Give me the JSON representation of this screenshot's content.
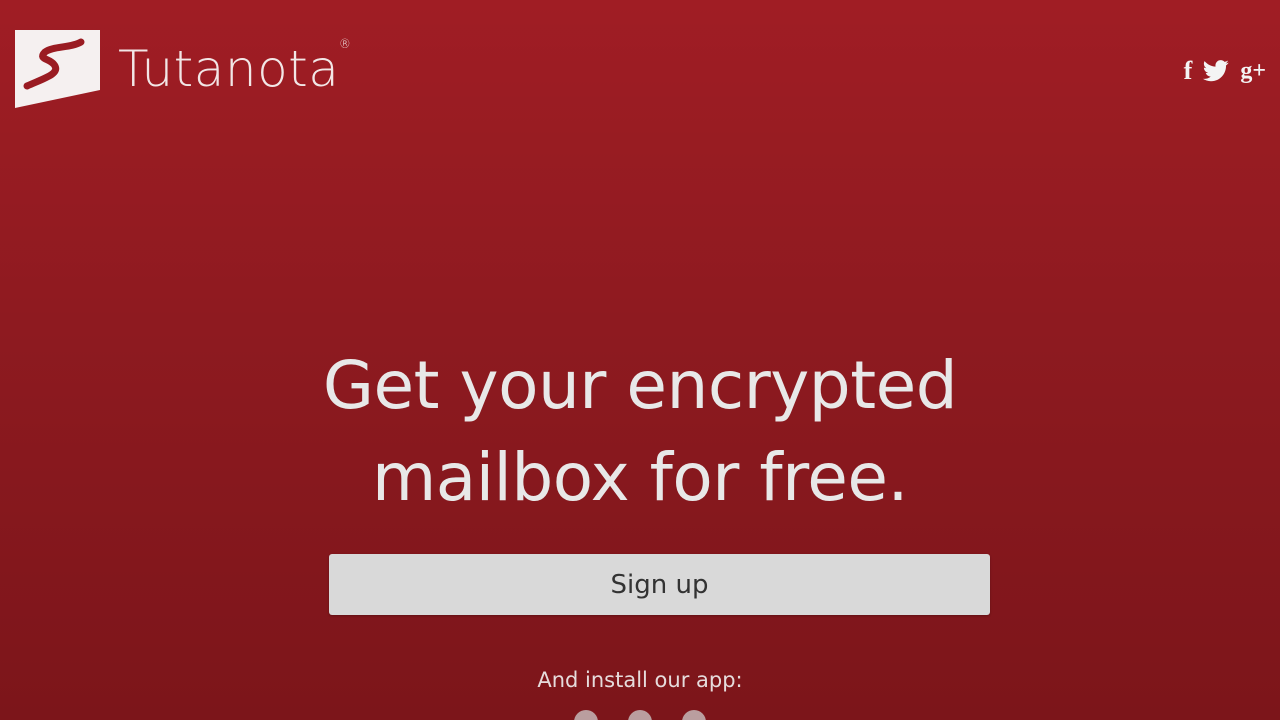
{
  "brand": {
    "name": "Tutanota",
    "registered_mark": "®",
    "logo_icon": "tutanota-logo-icon"
  },
  "social": [
    {
      "icon": "facebook-icon",
      "glyph": "f"
    },
    {
      "icon": "twitter-icon",
      "glyph": ""
    },
    {
      "icon": "google-plus-icon",
      "glyph": "g+"
    }
  ],
  "hero": {
    "headline_line1": "Get your encrypted",
    "headline_line2": "mailbox for free.",
    "signup_label": "Sign up",
    "install_text": "And install our app:"
  },
  "colors": {
    "background_top": "#a01d24",
    "background_bottom": "#7c151a",
    "button_bg": "#d9d9d9",
    "button_text": "#333333",
    "text": "#e8e8e8"
  }
}
